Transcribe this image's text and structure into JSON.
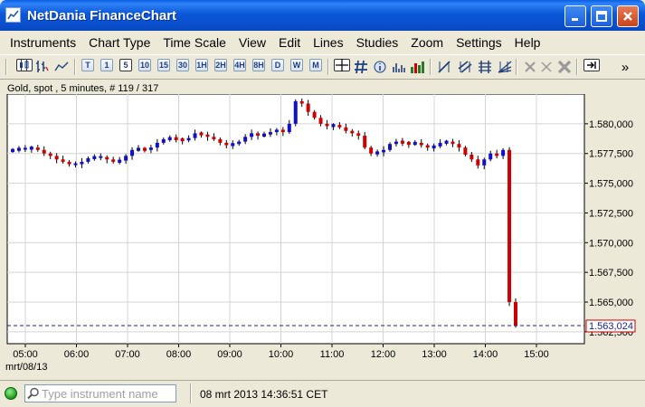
{
  "window": {
    "title": "NetDania FinanceChart",
    "minimize_icon": "minimize-icon",
    "maximize_icon": "maximize-icon",
    "close_icon": "close-icon"
  },
  "menu": [
    {
      "label": "Instruments"
    },
    {
      "label": "Chart Type"
    },
    {
      "label": "Time Scale"
    },
    {
      "label": "View"
    },
    {
      "label": "Edit"
    },
    {
      "label": "Lines"
    },
    {
      "label": "Studies"
    },
    {
      "label": "Zoom"
    },
    {
      "label": "Settings"
    },
    {
      "label": "Help"
    }
  ],
  "toolbar": {
    "timeframes": [
      "T",
      "1",
      "5",
      "10",
      "15",
      "30",
      "1H",
      "2H",
      "4H",
      "8H",
      "D",
      "W",
      "M"
    ],
    "active_timeframe": "5",
    "more_label": "»"
  },
  "chart": {
    "info": "Gold, spot , 5 minutes, # 119 / 317",
    "date_label": "mrt/08/13",
    "current_price_label": "1.563,024"
  },
  "chart_data": {
    "type": "candlestick",
    "title": "Gold, spot , 5 minutes, # 119 / 317",
    "x_ticks": [
      "05:00",
      "06:00",
      "07:00",
      "08:00",
      "09:00",
      "10:00",
      "11:00",
      "12:00",
      "13:00",
      "14:00",
      "15:00"
    ],
    "y_ticks": [
      "1.562,500",
      "1.565,000",
      "1.567,500",
      "1.570,000",
      "1.572,500",
      "1.575,000",
      "1.577,500",
      "1.580,000"
    ],
    "y_values": [
      1562.5,
      1565.0,
      1567.5,
      1570.0,
      1572.5,
      1575.0,
      1577.5,
      1580.0
    ],
    "ylim": [
      1561.5,
      1582.5
    ],
    "current_price": 1563.024,
    "up_color": "#1010c8",
    "down_color": "#cc0000",
    "grid": true,
    "series_close": [
      1577.8,
      1577.9,
      1577.9,
      1578.0,
      1577.8,
      1577.5,
      1577.3,
      1577.0,
      1576.8,
      1576.6,
      1576.6,
      1576.8,
      1577.1,
      1577.2,
      1577.2,
      1577.0,
      1576.8,
      1576.9,
      1577.3,
      1577.8,
      1577.9,
      1577.8,
      1578.0,
      1578.4,
      1578.7,
      1578.8,
      1578.7,
      1578.6,
      1578.8,
      1579.2,
      1579.1,
      1578.9,
      1578.7,
      1578.4,
      1578.2,
      1578.3,
      1578.5,
      1578.9,
      1579.2,
      1579.0,
      1579.1,
      1579.3,
      1579.5,
      1579.3,
      1580.0,
      1581.9,
      1581.7,
      1581.0,
      1580.5,
      1580.0,
      1579.8,
      1579.9,
      1579.7,
      1579.4,
      1579.2,
      1579.0,
      1578.0,
      1577.5,
      1577.6,
      1577.8,
      1578.3,
      1578.5,
      1578.4,
      1578.3,
      1578.4,
      1578.2,
      1578.0,
      1578.1,
      1578.4,
      1578.5,
      1578.3,
      1578.0,
      1577.4,
      1577.0,
      1576.5,
      1577.0,
      1577.5,
      1577.3,
      1577.8,
      1565.0,
      1563.0
    ]
  },
  "statusbar": {
    "search_placeholder": "Type instrument name",
    "time": "08 mrt 2013 14:36:51 CET"
  }
}
